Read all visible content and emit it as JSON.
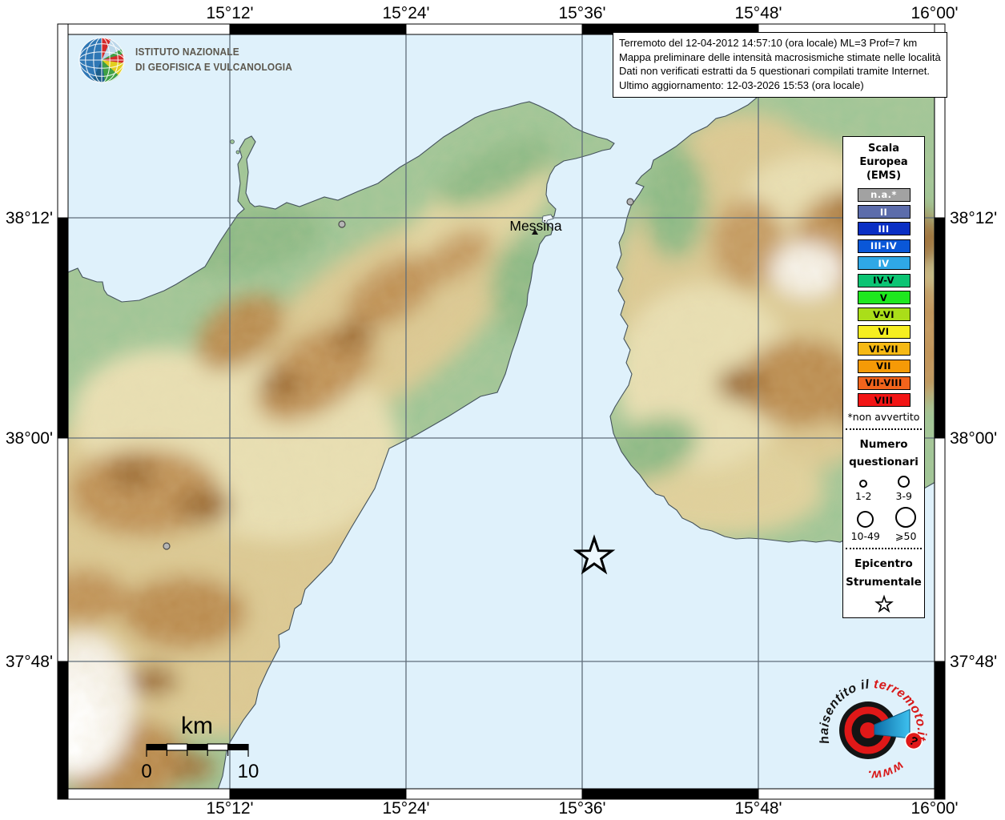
{
  "axes": {
    "lon": [
      "15°12'",
      "15°24'",
      "15°36'",
      "15°48'",
      "16°00'"
    ],
    "lat": [
      "38°12'",
      "38°00'",
      "37°48'"
    ]
  },
  "info_box": {
    "lines": [
      "Terremoto del 12-04-2012 14:57:10 (ora locale) ML=3 Prof=7 km",
      "Mappa preliminare delle intensità macrosismiche stimate nelle località",
      "Dati non verificati estratti da 5 questionari compilati tramite Internet.",
      "Ultimo aggiornamento: 12-03-2026 15:53 (ora locale)"
    ]
  },
  "ingv_logo": {
    "line1": "ISTITUTO NAZIONALE",
    "line2": "DI GEOFISICA E VULCANOLOGIA"
  },
  "legend": {
    "title_lines": [
      "Scala",
      "Europea",
      "(EMS)"
    ],
    "items": [
      {
        "label": "n.a.*",
        "color": "#a2a2a2",
        "text": "#ffffff"
      },
      {
        "label": "II",
        "color": "#5c6cab",
        "text": "#ffffff"
      },
      {
        "label": "III",
        "color": "#0a2fc4",
        "text": "#ffffff"
      },
      {
        "label": "III-IV",
        "color": "#0a57d8",
        "text": "#ffffff"
      },
      {
        "label": "IV",
        "color": "#2fa8e6",
        "text": "#ffffff"
      },
      {
        "label": "IV-V",
        "color": "#0cc473",
        "text": "#000000"
      },
      {
        "label": "V",
        "color": "#1fe81f",
        "text": "#000000"
      },
      {
        "label": "V-VI",
        "color": "#aade19",
        "text": "#000000"
      },
      {
        "label": "VI",
        "color": "#f6ee20",
        "text": "#000000"
      },
      {
        "label": "VI-VII",
        "color": "#f6b915",
        "text": "#000000"
      },
      {
        "label": "VII",
        "color": "#f59a07",
        "text": "#000000"
      },
      {
        "label": "VII-VIII",
        "color": "#f2641c",
        "text": "#000000"
      },
      {
        "label": "VIII",
        "color": "#f21515",
        "text": "#000000"
      }
    ],
    "footnote": "*non avvertito",
    "questionnaires_title_lines": [
      "Numero",
      "questionari"
    ],
    "size_classes": [
      "1-2",
      "3-9",
      "10-49",
      "⩾50"
    ],
    "epicenter_title_lines": [
      "Epicentro",
      "Strumentale"
    ]
  },
  "map_labels": {
    "city": "Messina"
  },
  "scalebar": {
    "unit": "km",
    "start": "0",
    "end": "10"
  },
  "site_logo": {
    "arc_black": "haisentito",
    "arc_mid": "il",
    "arc_red": "terremoto.it",
    "www": "www.",
    "badge": "?"
  },
  "colors": {
    "sea": "#dff1fb",
    "land": "#9fc697",
    "grid": "#5f6d79",
    "coast": "#44525c",
    "epicenter": "#000000",
    "site_red": "#e01818",
    "site_blue": "#2a9fd8"
  }
}
